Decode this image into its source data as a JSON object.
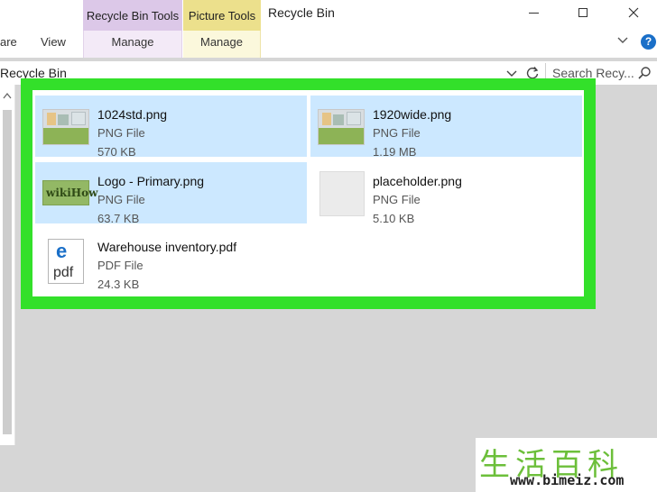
{
  "window": {
    "title": "Recycle Bin",
    "tool_tabs": [
      {
        "label": "Recycle Bin Tools",
        "sub": "Manage",
        "color": "#dcc8e8"
      },
      {
        "label": "Picture Tools",
        "sub": "Manage",
        "color": "#ece08c"
      }
    ],
    "menu": {
      "share": "are",
      "view": "View"
    },
    "help": "?"
  },
  "address": {
    "location": "Recycle Bin",
    "search_placeholder": "Search Recy..."
  },
  "highlight_color": "#33e02a",
  "files": [
    {
      "name": "1024std.png",
      "type": "PNG File",
      "size": "570 KB",
      "selected": true,
      "thumb": "screenshot"
    },
    {
      "name": "1920wide.png",
      "type": "PNG File",
      "size": "1.19 MB",
      "selected": true,
      "thumb": "screenshot"
    },
    {
      "name": "Logo - Primary.png",
      "type": "PNG File",
      "size": "63.7 KB",
      "selected": true,
      "thumb": "logo"
    },
    {
      "name": "placeholder.png",
      "type": "PNG File",
      "size": "5.10 KB",
      "selected": false,
      "thumb": "blank"
    },
    {
      "name": "Warehouse inventory.pdf",
      "type": "PDF File",
      "size": "24.3 KB",
      "selected": false,
      "thumb": "pdf"
    }
  ],
  "thumbs": {
    "logo_text": "wikiHow",
    "pdf_label": "pdf",
    "pdf_glyph": "e"
  },
  "watermark": {
    "text": "生活百科",
    "url": "www.bimeiz.com"
  }
}
